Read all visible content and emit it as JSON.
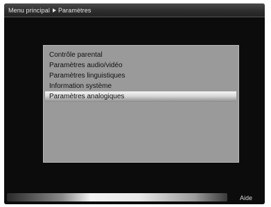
{
  "breadcrumb": {
    "parent": "Menu principal",
    "arrow_icon": "right-arrow-icon",
    "current": "Paramètres"
  },
  "menu": {
    "items": [
      {
        "label": "Contrôle parental",
        "selected": false
      },
      {
        "label": "Paramètres audio/vidéo",
        "selected": false
      },
      {
        "label": "Paramètres linguistiques",
        "selected": false
      },
      {
        "label": "Information système",
        "selected": false
      },
      {
        "label": "Paramètres analogiques",
        "selected": true
      }
    ]
  },
  "footer": {
    "help_label": "Aide"
  },
  "colors": {
    "screen_background": "#0c0c0c",
    "panel_background": "#9a9a9a",
    "selection_highlight": "#e8e8e8"
  }
}
